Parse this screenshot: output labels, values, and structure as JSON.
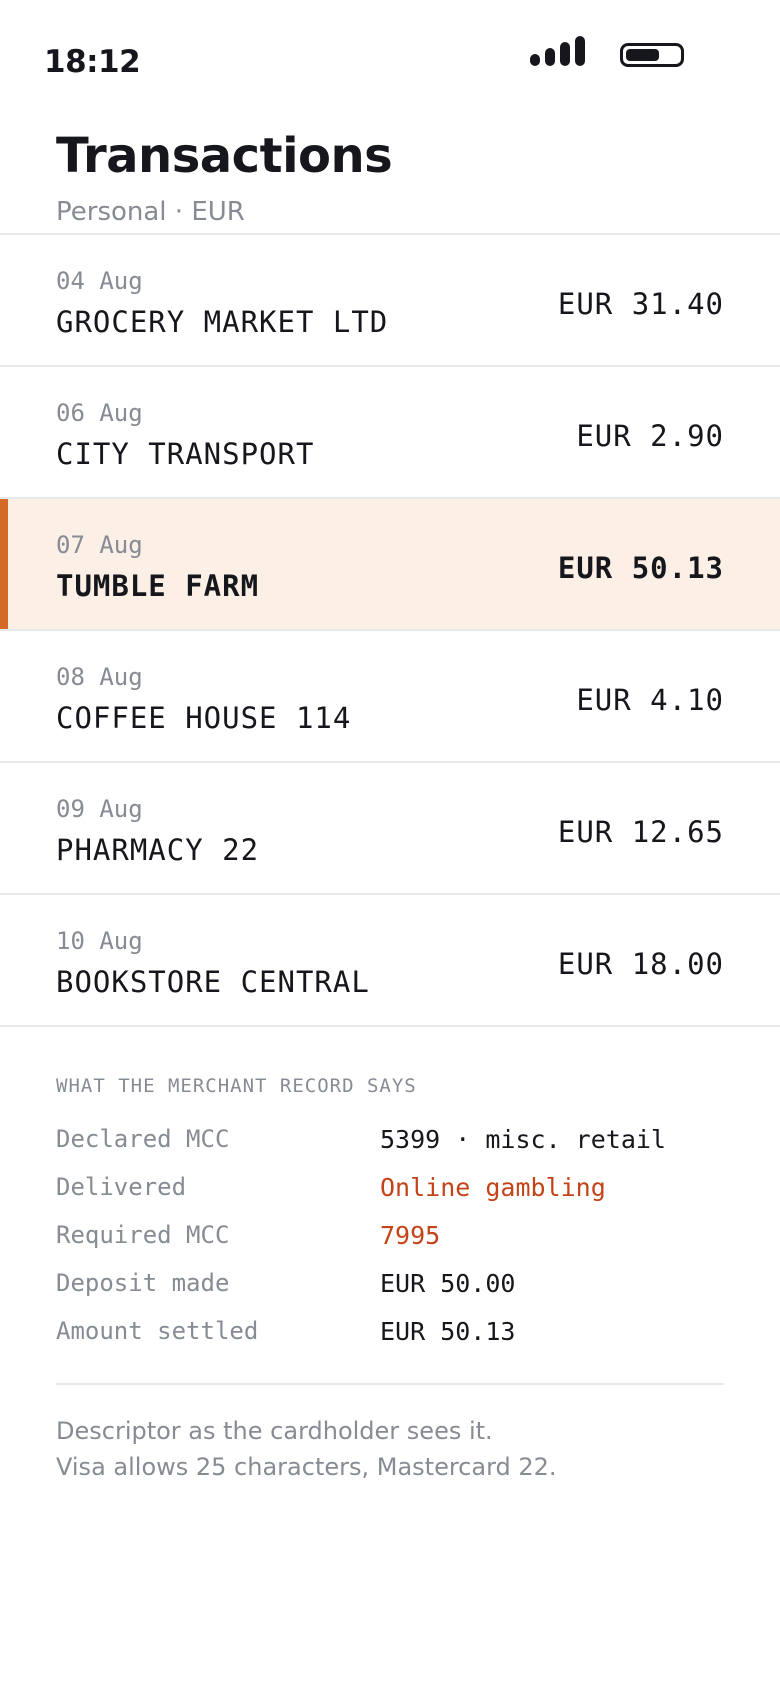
{
  "status_bar": {
    "time": "18:12"
  },
  "header": {
    "title": "Transactions",
    "subtitle": "Personal · EUR"
  },
  "transactions": [
    {
      "date": "04 Aug",
      "merchant": "GROCERY MARKET LTD",
      "amount": "EUR 31.40"
    },
    {
      "date": "06 Aug",
      "merchant": "CITY TRANSPORT",
      "amount": "EUR 2.90"
    },
    {
      "date": "07 Aug",
      "merchant": "TUMBLE FARM",
      "amount": "EUR 50.13",
      "flagged": true
    },
    {
      "date": "08 Aug",
      "merchant": "COFFEE HOUSE 114",
      "amount": "EUR 4.10"
    },
    {
      "date": "09 Aug",
      "merchant": "PHARMACY 22",
      "amount": "EUR 12.65"
    },
    {
      "date": "10 Aug",
      "merchant": "BOOKSTORE CENTRAL",
      "amount": "EUR 18.00"
    }
  ],
  "merchant_record": {
    "heading": "WHAT THE MERCHANT RECORD SAYS",
    "rows": [
      {
        "label": "Declared MCC",
        "value": "5399 · misc. retail"
      },
      {
        "label": "Delivered",
        "value": "Online gambling",
        "alert": true
      },
      {
        "label": "Required MCC",
        "value": "7995",
        "alert": true
      },
      {
        "label": "Deposit made",
        "value": "EUR 50.00"
      },
      {
        "label": "Amount settled",
        "value": "EUR 50.13"
      }
    ]
  },
  "footnote": {
    "line1": "Descriptor as the cardholder sees it.",
    "line2": "Visa allows 25 characters, Mastercard 22."
  },
  "colors": {
    "flag_accent": "#d46a28",
    "flag_background": "#fcefe6",
    "alert_text": "#c4441a"
  },
  "icons": {
    "signal": "signal-icon",
    "battery": "battery-icon"
  }
}
